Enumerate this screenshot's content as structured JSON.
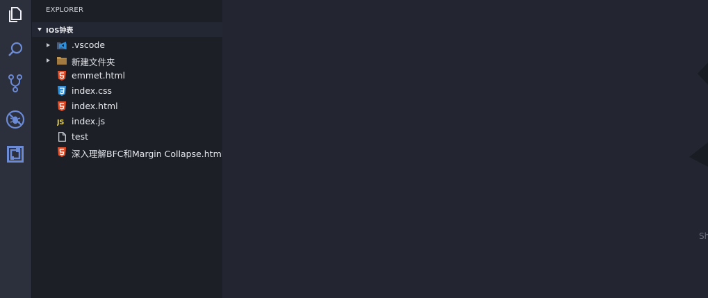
{
  "sidebar": {
    "title": "EXPLORER",
    "folder": {
      "name": "IOS钟表"
    },
    "items": [
      {
        "label": ".vscode",
        "icon": "vscode-folder-icon",
        "expandable": true
      },
      {
        "label": "新建文件夹",
        "icon": "folder-icon",
        "expandable": true
      },
      {
        "label": "emmet.html",
        "icon": "html5-icon",
        "expandable": false
      },
      {
        "label": "index.css",
        "icon": "css3-icon",
        "expandable": false
      },
      {
        "label": "index.html",
        "icon": "html5-icon",
        "expandable": false
      },
      {
        "label": "index.js",
        "icon": "js-icon",
        "expandable": false
      },
      {
        "label": "test",
        "icon": "file-icon",
        "expandable": false
      },
      {
        "label": "深入理解BFC和Margin Collapse.html",
        "icon": "html5-icon",
        "expandable": false
      }
    ]
  },
  "activity_bar": [
    "explorer-icon",
    "search-icon",
    "source-control-icon",
    "debug-icon",
    "extensions-icon"
  ],
  "editor": {
    "edge_text": "Sh"
  },
  "colors": {
    "activity_icon": "#6b8bd6",
    "html": "#e44d26",
    "css": "#2e8fd8",
    "js": "#e8d44d",
    "folder": "#c09553"
  }
}
